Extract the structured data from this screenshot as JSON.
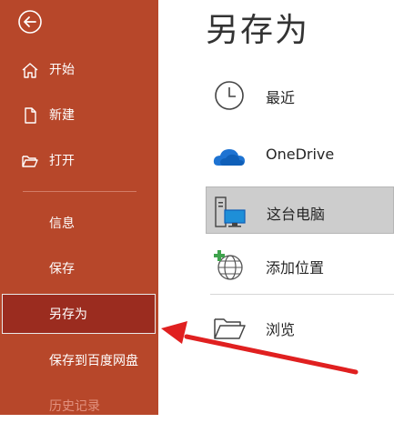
{
  "sidebar": {
    "items": [
      {
        "label": "开始",
        "icon": "home-icon"
      },
      {
        "label": "新建",
        "icon": "new-document-icon"
      },
      {
        "label": "打开",
        "icon": "open-folder-icon"
      }
    ],
    "plain_items": [
      {
        "label": "信息"
      },
      {
        "label": "保存"
      },
      {
        "label": "另存为"
      },
      {
        "label": "保存到百度网盘"
      },
      {
        "label": "历史记录"
      }
    ]
  },
  "main": {
    "title": "另存为",
    "locations": [
      {
        "label": "最近",
        "icon": "clock-icon"
      },
      {
        "label": "OneDrive",
        "icon": "cloud-icon"
      },
      {
        "label": "这台电脑",
        "icon": "computer-icon"
      },
      {
        "label": "添加位置",
        "icon": "add-location-globe-icon"
      },
      {
        "label": "浏览",
        "icon": "folder-icon"
      }
    ]
  },
  "colors": {
    "sidebar_bg": "#b7472a",
    "selected_bg": "#9b2c1f",
    "arrow": "#e02020"
  }
}
